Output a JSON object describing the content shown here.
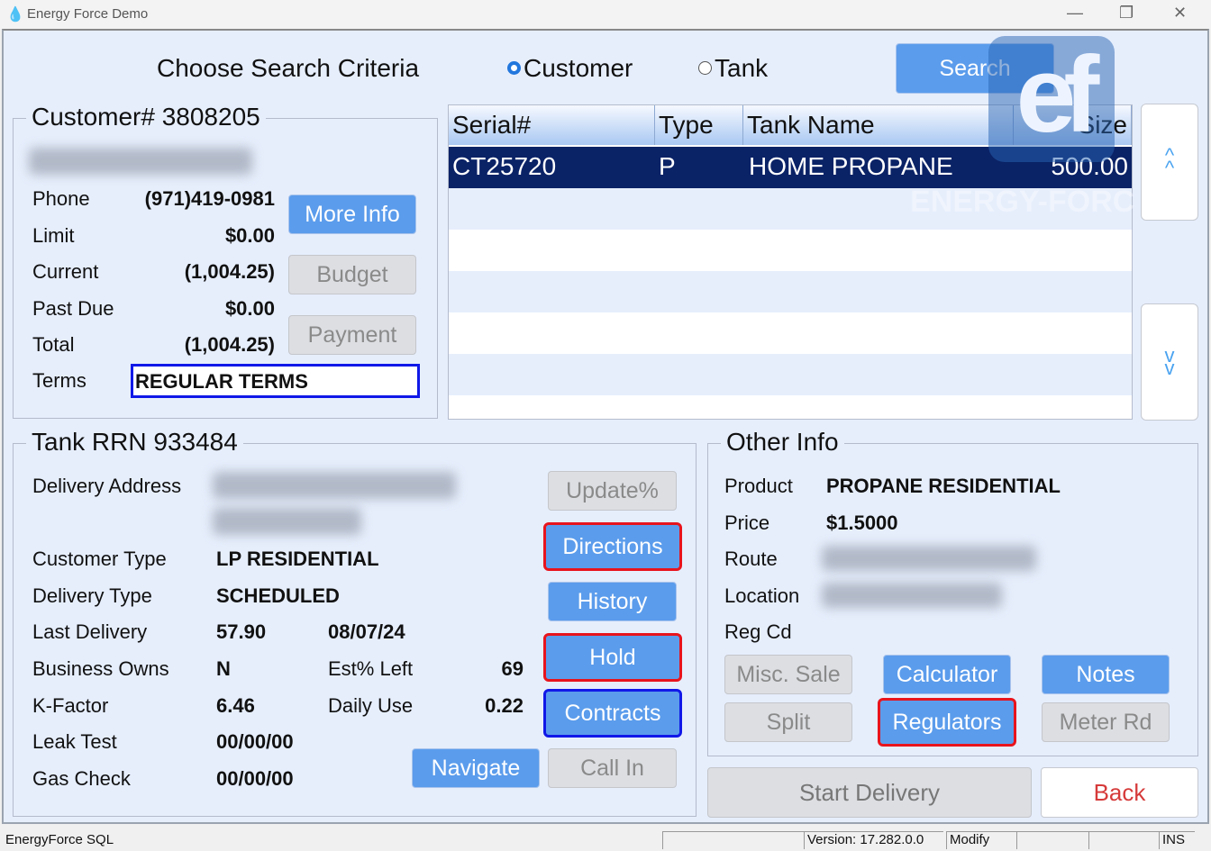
{
  "window": {
    "title": "Energy Force Demo",
    "minimize": "—",
    "maximize": "❐",
    "close": "✕"
  },
  "search": {
    "label": "Choose Search Criteria",
    "options": [
      {
        "label": "Customer",
        "selected": true
      },
      {
        "label": "Tank",
        "selected": false
      }
    ],
    "button": "Search"
  },
  "customer": {
    "legend": "Customer# 3808205",
    "fields": [
      {
        "label": "Phone",
        "value": "(971)419-0981"
      },
      {
        "label": "Limit",
        "value": "$0.00"
      },
      {
        "label": "Current",
        "value": "(1,004.25)"
      },
      {
        "label": "Past Due",
        "value": "$0.00"
      },
      {
        "label": "Total",
        "value": "(1,004.25)"
      }
    ],
    "terms_label": "Terms",
    "terms_value": "REGULAR TERMS",
    "buttons": {
      "more_info": "More Info",
      "budget": "Budget",
      "payment": "Payment"
    }
  },
  "grid": {
    "columns": [
      "Serial#",
      "Type",
      "Tank Name",
      "Size"
    ],
    "rows": [
      {
        "serial": "CT25720",
        "type": "P",
        "name": "HOME PROPANE",
        "size": "500.00"
      }
    ],
    "scroll_up": "^^",
    "scroll_down": "vv"
  },
  "logo": {
    "text": "ef",
    "watermark": "ENERGY-FORCE"
  },
  "tank": {
    "legend": "Tank RRN 933484",
    "delivery_address_label": "Delivery Address",
    "customer_type_label": "Customer Type",
    "customer_type": "LP RESIDENTIAL",
    "delivery_type_label": "Delivery Type",
    "delivery_type": "SCHEDULED",
    "last_delivery_label": "Last Delivery",
    "last_delivery_amount": "57.90",
    "last_delivery_date": "08/07/24",
    "business_owns_label": "Business Owns",
    "business_owns": "N",
    "est_left_label": "Est% Left",
    "est_left": "69",
    "kfactor_label": "K-Factor",
    "kfactor": "6.46",
    "daily_use_label": "Daily Use",
    "daily_use": "0.22",
    "leak_test_label": "Leak Test",
    "leak_test": "00/00/00",
    "gas_check_label": "Gas Check",
    "gas_check": "00/00/00",
    "buttons": {
      "update": "Update%",
      "directions": "Directions",
      "history": "History",
      "hold": "Hold",
      "contracts": "Contracts",
      "navigate": "Navigate",
      "call_in": "Call In"
    }
  },
  "other": {
    "legend": "Other Info",
    "product_label": "Product",
    "product": "PROPANE RESIDENTIAL",
    "price_label": "Price",
    "price": "$1.5000",
    "route_label": "Route",
    "location_label": "Location",
    "regcd_label": "Reg Cd",
    "buttons": {
      "misc_sale": "Misc. Sale",
      "calculator": "Calculator",
      "notes": "Notes",
      "split": "Split",
      "regulators": "Regulators",
      "meter_rd": "Meter Rd"
    }
  },
  "footer": {
    "start_delivery": "Start Delivery",
    "back": "Back"
  },
  "status": {
    "app": "EnergyForce SQL",
    "version": "Version: 17.282.0.0",
    "mode": "Modify",
    "ins": "INS"
  },
  "colors": {
    "button": "#5b9cec",
    "selected_row": "#0a2266",
    "background": "#e6eefc",
    "highlight_red": "#e8141c",
    "highlight_blue": "#1018e8",
    "back_text": "#d63a3a"
  }
}
